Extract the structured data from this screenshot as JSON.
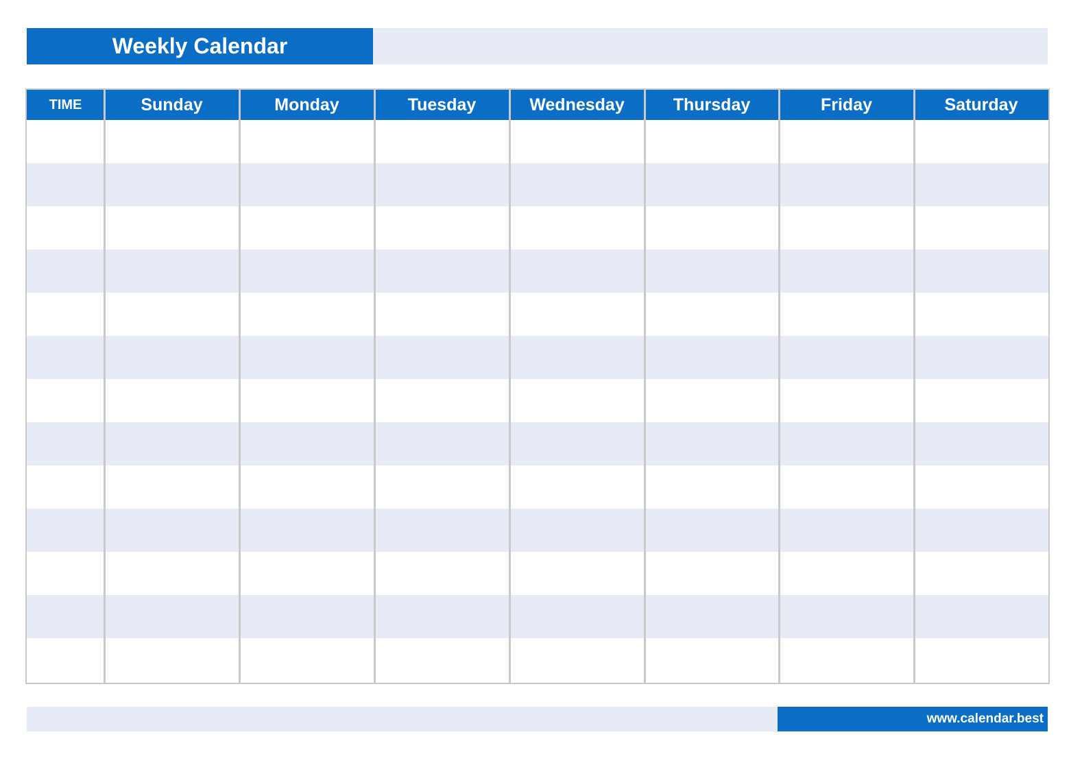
{
  "header": {
    "title": "Weekly Calendar"
  },
  "table": {
    "columns": [
      "TIME",
      "Sunday",
      "Monday",
      "Tuesday",
      "Wednesday",
      "Thursday",
      "Friday",
      "Saturday"
    ],
    "row_count": 13,
    "rows": [
      [
        "",
        "",
        "",
        "",
        "",
        "",
        "",
        ""
      ],
      [
        "",
        "",
        "",
        "",
        "",
        "",
        "",
        ""
      ],
      [
        "",
        "",
        "",
        "",
        "",
        "",
        "",
        ""
      ],
      [
        "",
        "",
        "",
        "",
        "",
        "",
        "",
        ""
      ],
      [
        "",
        "",
        "",
        "",
        "",
        "",
        "",
        ""
      ],
      [
        "",
        "",
        "",
        "",
        "",
        "",
        "",
        ""
      ],
      [
        "",
        "",
        "",
        "",
        "",
        "",
        "",
        ""
      ],
      [
        "",
        "",
        "",
        "",
        "",
        "",
        "",
        ""
      ],
      [
        "",
        "",
        "",
        "",
        "",
        "",
        "",
        ""
      ],
      [
        "",
        "",
        "",
        "",
        "",
        "",
        "",
        ""
      ],
      [
        "",
        "",
        "",
        "",
        "",
        "",
        "",
        ""
      ],
      [
        "",
        "",
        "",
        "",
        "",
        "",
        "",
        ""
      ],
      [
        "",
        "",
        "",
        "",
        "",
        "",
        "",
        ""
      ]
    ]
  },
  "footer": {
    "website": "www.calendar.best"
  },
  "colors": {
    "accent": "#0a6ec6",
    "stripe": "#e6ebf6",
    "grid": "#c9c9c9"
  }
}
